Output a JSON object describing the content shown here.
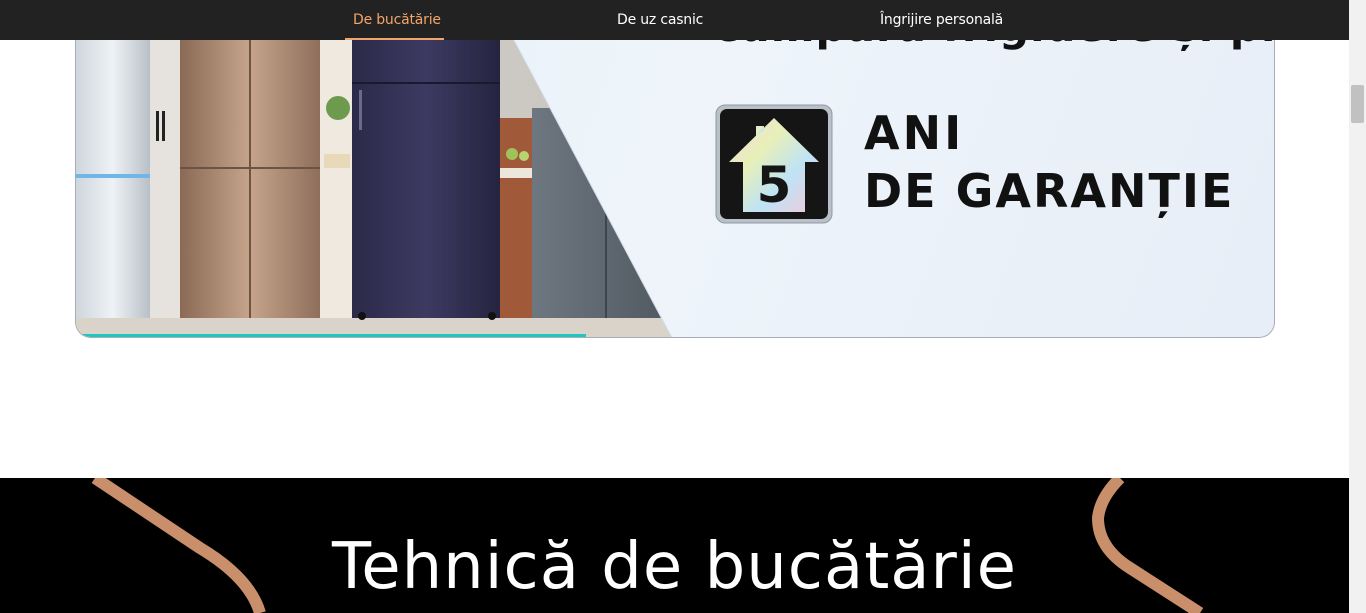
{
  "nav": {
    "tabs": [
      {
        "label": "De bucătărie",
        "active": true
      },
      {
        "label": "De uz casnic",
        "active": false
      },
      {
        "label": "Îngrijire personală",
        "active": false
      }
    ]
  },
  "banner": {
    "headline": "cumpără frigidere și primești",
    "warranty_icon": "house-5-icon",
    "warranty_number": "5",
    "warranty_line1": "ANI",
    "warranty_line2": "DE GARANȚIE"
  },
  "section": {
    "title": "Tehnică de bucătărie"
  },
  "colors": {
    "nav_bg": "#222222",
    "nav_active": "#f2a56b",
    "progress": "#1fc7c0",
    "section_bg": "#000000",
    "deco_stroke": "#c98e6a"
  }
}
